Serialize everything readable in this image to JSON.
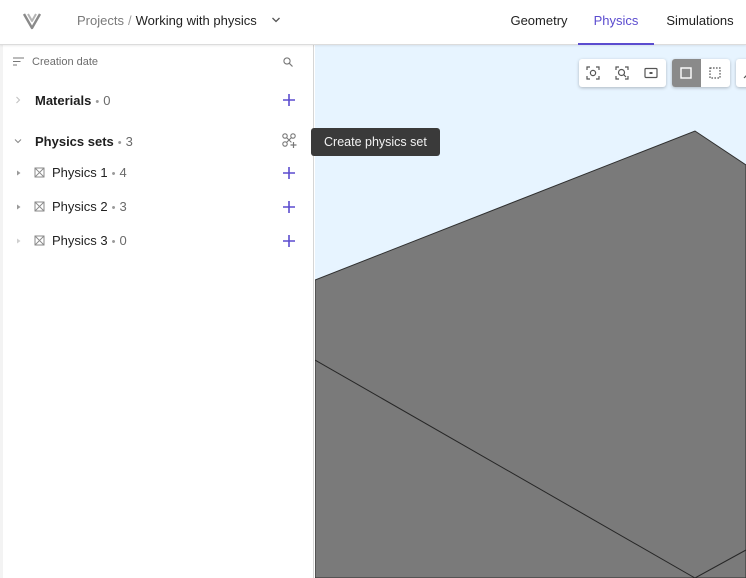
{
  "breadcrumb": {
    "root": "Projects",
    "separator": "/",
    "current": "Working with physics"
  },
  "tabs": [
    {
      "label": "Geometry",
      "active": false
    },
    {
      "label": "Physics",
      "active": true
    },
    {
      "label": "Simulations",
      "active": false
    }
  ],
  "panel": {
    "sort_label": "Creation date",
    "materials": {
      "label": "Materials",
      "dot": "•",
      "count": "0"
    },
    "physics_sets": {
      "label": "Physics sets",
      "dot": "•",
      "count": "3"
    },
    "items": [
      {
        "label": "Physics 1",
        "dot": "•",
        "count": "4"
      },
      {
        "label": "Physics 2",
        "dot": "•",
        "count": "3"
      },
      {
        "label": "Physics 3",
        "dot": "•",
        "count": "0"
      }
    ]
  },
  "tooltip": {
    "text": "Create physics set"
  },
  "icons": {
    "logo": "app-logo-icon",
    "sort": "sort-icon",
    "search": "search-icon",
    "add": "plus-icon",
    "create_physics_set": "create-physics-set-icon",
    "physics_item": "physics-item-icon"
  },
  "colors": {
    "accent": "#5b4ccf",
    "viewport_bg": "#e7f4ff",
    "geometry": "#7a7a7a",
    "tooltip_bg": "#3a3a3a"
  }
}
